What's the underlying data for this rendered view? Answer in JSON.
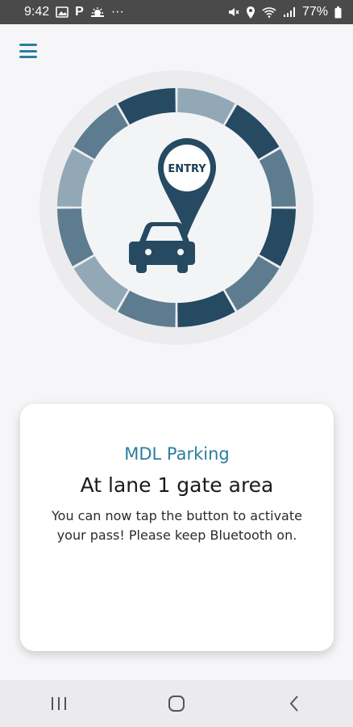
{
  "status_bar": {
    "time": "9:42",
    "p_label": "P",
    "more": "···",
    "battery": "77%",
    "icons": [
      "image-icon",
      "parking-icon",
      "weather-icon",
      "more-icon",
      "mute-icon",
      "location-icon",
      "wifi-icon",
      "signal-icon",
      "battery-icon"
    ]
  },
  "header": {
    "menu_icon": "hamburger-menu-icon"
  },
  "gauge": {
    "badge_text": "ENTRY",
    "icons": [
      "location-pin-icon",
      "car-icon"
    ],
    "colors": {
      "dark": "#254a62",
      "mid": "#5d7c90",
      "light": "#93a8b7",
      "accent": "#2a7f9e"
    }
  },
  "card": {
    "location": "MDL Parking",
    "title": "At lane 1 gate area",
    "message": "You can now tap the button to activate your pass! Please keep Bluetooth on."
  },
  "nav": {
    "icons": [
      "recent-apps-icon",
      "home-icon",
      "back-icon"
    ]
  }
}
